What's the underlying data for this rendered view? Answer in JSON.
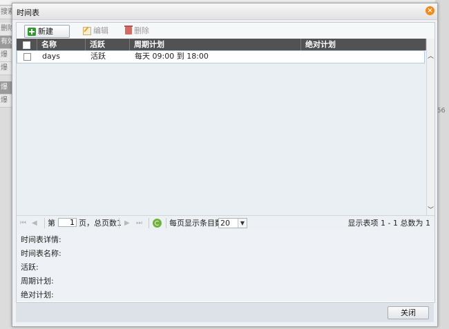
{
  "background": {
    "left_fragments": [
      "搜索",
      "删除",
      "有效",
      "爆",
      "爆",
      "爆",
      "爆"
    ],
    "right_fragment": "66"
  },
  "dialog": {
    "title": "时间表",
    "close_icon": "close-icon"
  },
  "toolbar": {
    "new_label": "新建",
    "edit_label": "编辑",
    "delete_label": "删除"
  },
  "grid": {
    "columns": [
      "名称",
      "活跃",
      "周期计划",
      "绝对计划"
    ],
    "rows": [
      {
        "name": "days",
        "active": "活跃",
        "periodic": "每天 09:00 到 18:00",
        "absolute": ""
      }
    ]
  },
  "pager": {
    "page_prefix": "第",
    "page_value": "1",
    "page_suffix": "页，总页数1",
    "page_size_label": "每页显示条目数",
    "page_size_value": "20",
    "summary": "显示表项 1 - 1 总数为 1"
  },
  "details": {
    "heading": "时间表详情:",
    "name_label": "时间表名称:",
    "active_label": "活跃:",
    "periodic_label": "周期计划:",
    "absolute_label": "绝对计划:"
  },
  "footer": {
    "close_label": "关闭"
  },
  "colors": {
    "header_bg": "#525252",
    "close_icon": "#f08a1a",
    "row_border": "#b6c8dc"
  }
}
